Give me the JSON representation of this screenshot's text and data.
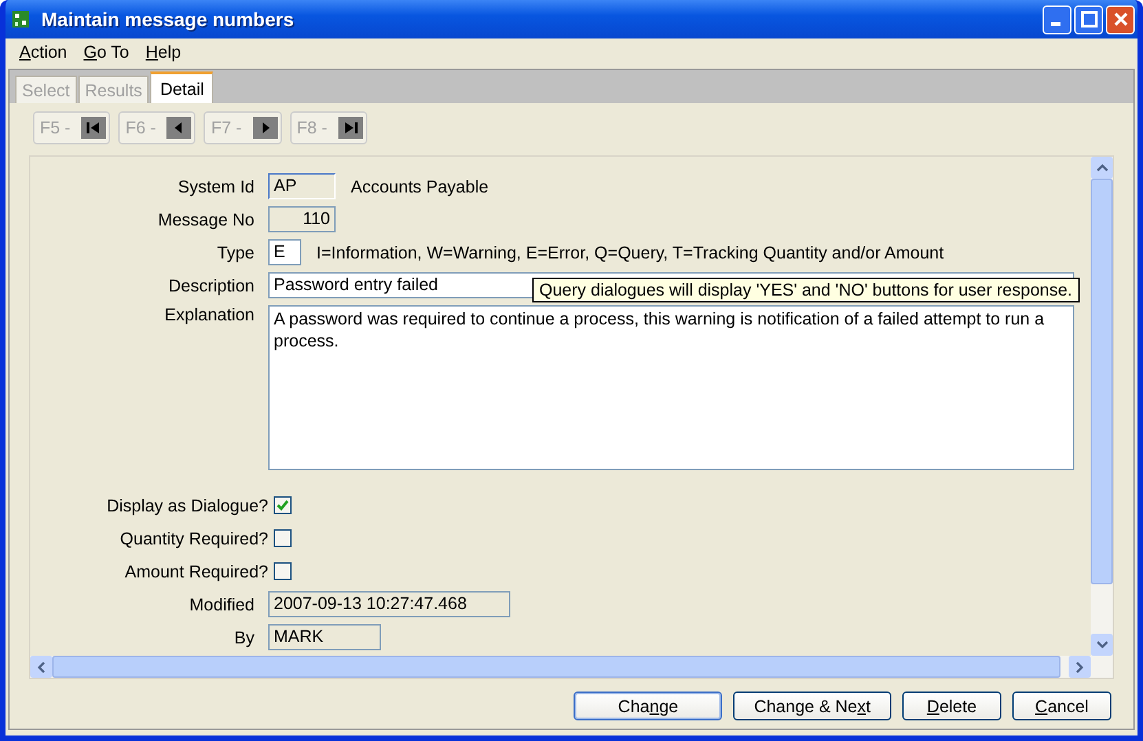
{
  "window": {
    "title": "Maintain message numbers"
  },
  "menu": [
    {
      "label": "Action"
    },
    {
      "label": "Go To"
    },
    {
      "label": "Help"
    }
  ],
  "tabs": [
    {
      "label": "Select",
      "selected": false,
      "disabled": true
    },
    {
      "label": "Results",
      "selected": false,
      "disabled": true
    },
    {
      "label": "Detail",
      "selected": true,
      "disabled": false
    }
  ],
  "nav_buttons": [
    {
      "label": "F5 -",
      "kind": "first",
      "disabled": true
    },
    {
      "label": "F6 -",
      "kind": "prev",
      "disabled": true
    },
    {
      "label": "F7 -",
      "kind": "next",
      "disabled": true
    },
    {
      "label": "F8 -",
      "kind": "last",
      "disabled": true
    }
  ],
  "form": {
    "system_id": {
      "label": "System Id",
      "value": "AP",
      "note": "Accounts Payable"
    },
    "message_no": {
      "label": "Message No",
      "value": "110"
    },
    "type": {
      "label": "Type",
      "value": "E",
      "note": "I=Information, W=Warning, E=Error, Q=Query, T=Tracking Quantity and/or Amount"
    },
    "description": {
      "label": "Description",
      "value": "Password entry failed"
    },
    "tooltip": "Query dialogues will display 'YES' and 'NO' buttons for user response.",
    "explanation": {
      "label": "Explanation",
      "value": "A password was required to continue a process, this warning is notification of a failed attempt to run a process."
    },
    "checkboxes": [
      {
        "label": "Display as Dialogue?",
        "checked": true
      },
      {
        "label": "Quantity Required?",
        "checked": false
      },
      {
        "label": "Amount Required?",
        "checked": false
      }
    ],
    "modified": {
      "label": "Modified",
      "value": "2007-09-13 10:27:47.468"
    },
    "by": {
      "label": "By",
      "value": "MARK"
    }
  },
  "buttons": [
    {
      "label": "Change",
      "default": true
    },
    {
      "label": "Change & Next",
      "default": false
    },
    {
      "label": "Delete",
      "default": false
    },
    {
      "label": "Cancel",
      "default": false
    }
  ]
}
